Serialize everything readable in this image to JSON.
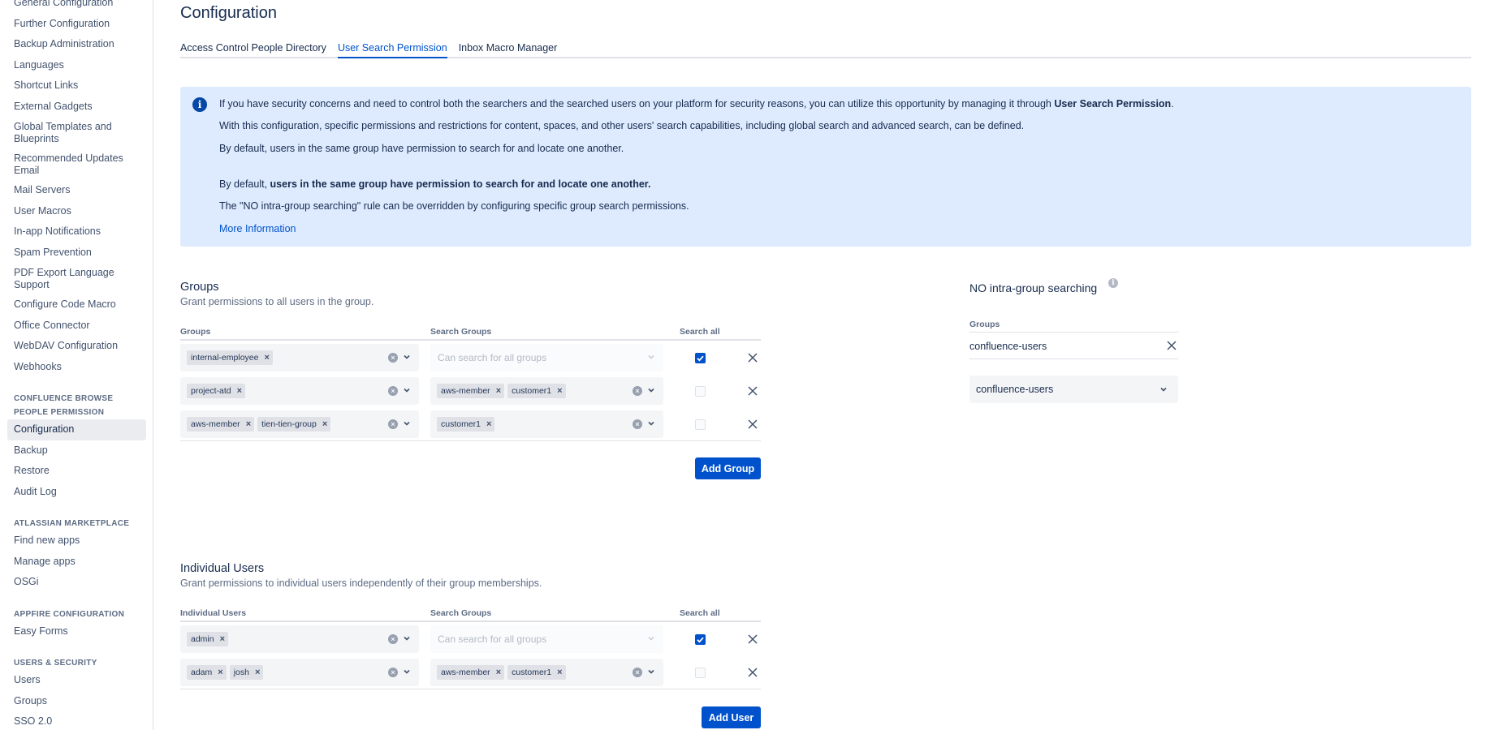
{
  "sidebar": {
    "general_items": [
      {
        "label": "General Configuration",
        "lines": 1
      },
      {
        "label": "Further Configuration",
        "lines": 1
      },
      {
        "label": "Backup Administration",
        "lines": 1
      },
      {
        "label": "Languages",
        "lines": 1
      },
      {
        "label": "Shortcut Links",
        "lines": 1
      },
      {
        "label": "External Gadgets",
        "lines": 1
      },
      {
        "label": "Global Templates and Blueprints",
        "lines": 2
      },
      {
        "label": "Recommended Updates Email",
        "lines": 2
      },
      {
        "label": "Mail Servers",
        "lines": 1
      },
      {
        "label": "User Macros",
        "lines": 1
      },
      {
        "label": "In-app Notifications",
        "lines": 1
      },
      {
        "label": "Spam Prevention",
        "lines": 1
      },
      {
        "label": "PDF Export Language Support",
        "lines": 2
      },
      {
        "label": "Configure Code Macro",
        "lines": 1
      },
      {
        "label": "Office Connector",
        "lines": 1
      },
      {
        "label": "WebDAV Configuration",
        "lines": 1
      },
      {
        "label": "Webhooks",
        "lines": 1
      }
    ],
    "sections": [
      {
        "heading": "CONFLUENCE BROWSE PEOPLE PERMISSION",
        "items": [
          "Configuration",
          "Backup",
          "Restore",
          "Audit Log"
        ],
        "active": "Configuration"
      },
      {
        "heading": "ATLASSIAN MARKETPLACE",
        "items": [
          "Find new apps",
          "Manage apps",
          "OSGi"
        ]
      },
      {
        "heading": "APPFIRE CONFIGURATION",
        "items": [
          "Easy Forms"
        ]
      },
      {
        "heading": "USERS & SECURITY",
        "items": [
          "Users",
          "Groups",
          "SSO 2.0"
        ]
      }
    ]
  },
  "page": {
    "title": "Configuration"
  },
  "tabs": [
    "Access Control People Directory",
    "User Search Permission",
    "Inbox Macro Manager"
  ],
  "active_tab": "User Search Permission",
  "info": {
    "line1_pre": "If you have security concerns and need to control both the searchers and the searched users on your platform for security reasons, you can utilize this opportunity by managing it through ",
    "line1_bold": "User Search Permission",
    "line1_post": ".",
    "line2": "With this configuration, specific permissions and restrictions for content, spaces, and other users' search capabilities, including global search and advanced search, can be defined.",
    "line3": "By default, users in the same group have permission to search for and locate one another.",
    "line4_pre": "By default, ",
    "line4_bold": "users in the same group have permission to search for and locate one another.",
    "line5": "The \"NO intra-group searching\" rule can be overridden by configuring specific group search permissions.",
    "link": "More Information"
  },
  "groups": {
    "title": "Groups",
    "subtitle": "Grant permissions to all users in the group.",
    "col_groups": "Groups",
    "col_search_groups": "Search Groups",
    "col_search_all": "Search all",
    "placeholder": "Can search for all groups",
    "rows": [
      {
        "groups": [
          "internal-employee"
        ],
        "search_groups": [],
        "search_all": true
      },
      {
        "groups": [
          "project-atd"
        ],
        "search_groups": [
          "aws-member",
          "customer1"
        ],
        "search_all": false
      },
      {
        "groups": [
          "aws-member",
          "tien-tien-group"
        ],
        "search_groups": [
          "customer1"
        ],
        "search_all": false
      }
    ],
    "add_button": "Add Group"
  },
  "individual": {
    "title": "Individual Users",
    "subtitle": "Grant permissions to individual users independently of their group memberships.",
    "col_users": "Individual Users",
    "col_search_groups": "Search Groups",
    "col_search_all": "Search all",
    "placeholder": "Can search for all groups",
    "rows": [
      {
        "users": [
          "admin"
        ],
        "search_groups": [],
        "search_all": true
      },
      {
        "users": [
          "adam",
          "josh"
        ],
        "search_groups": [
          "aws-member",
          "customer1"
        ],
        "search_all": false
      }
    ],
    "add_button": "Add User"
  },
  "no_intra": {
    "title": "NO intra-group searching",
    "groups_label": "Groups",
    "selected_value": "confluence-users",
    "dropdown_value": "confluence-users"
  },
  "colors": {
    "accent": "#0052cc",
    "info_bg": "#deebff",
    "text": "#172b4d"
  }
}
